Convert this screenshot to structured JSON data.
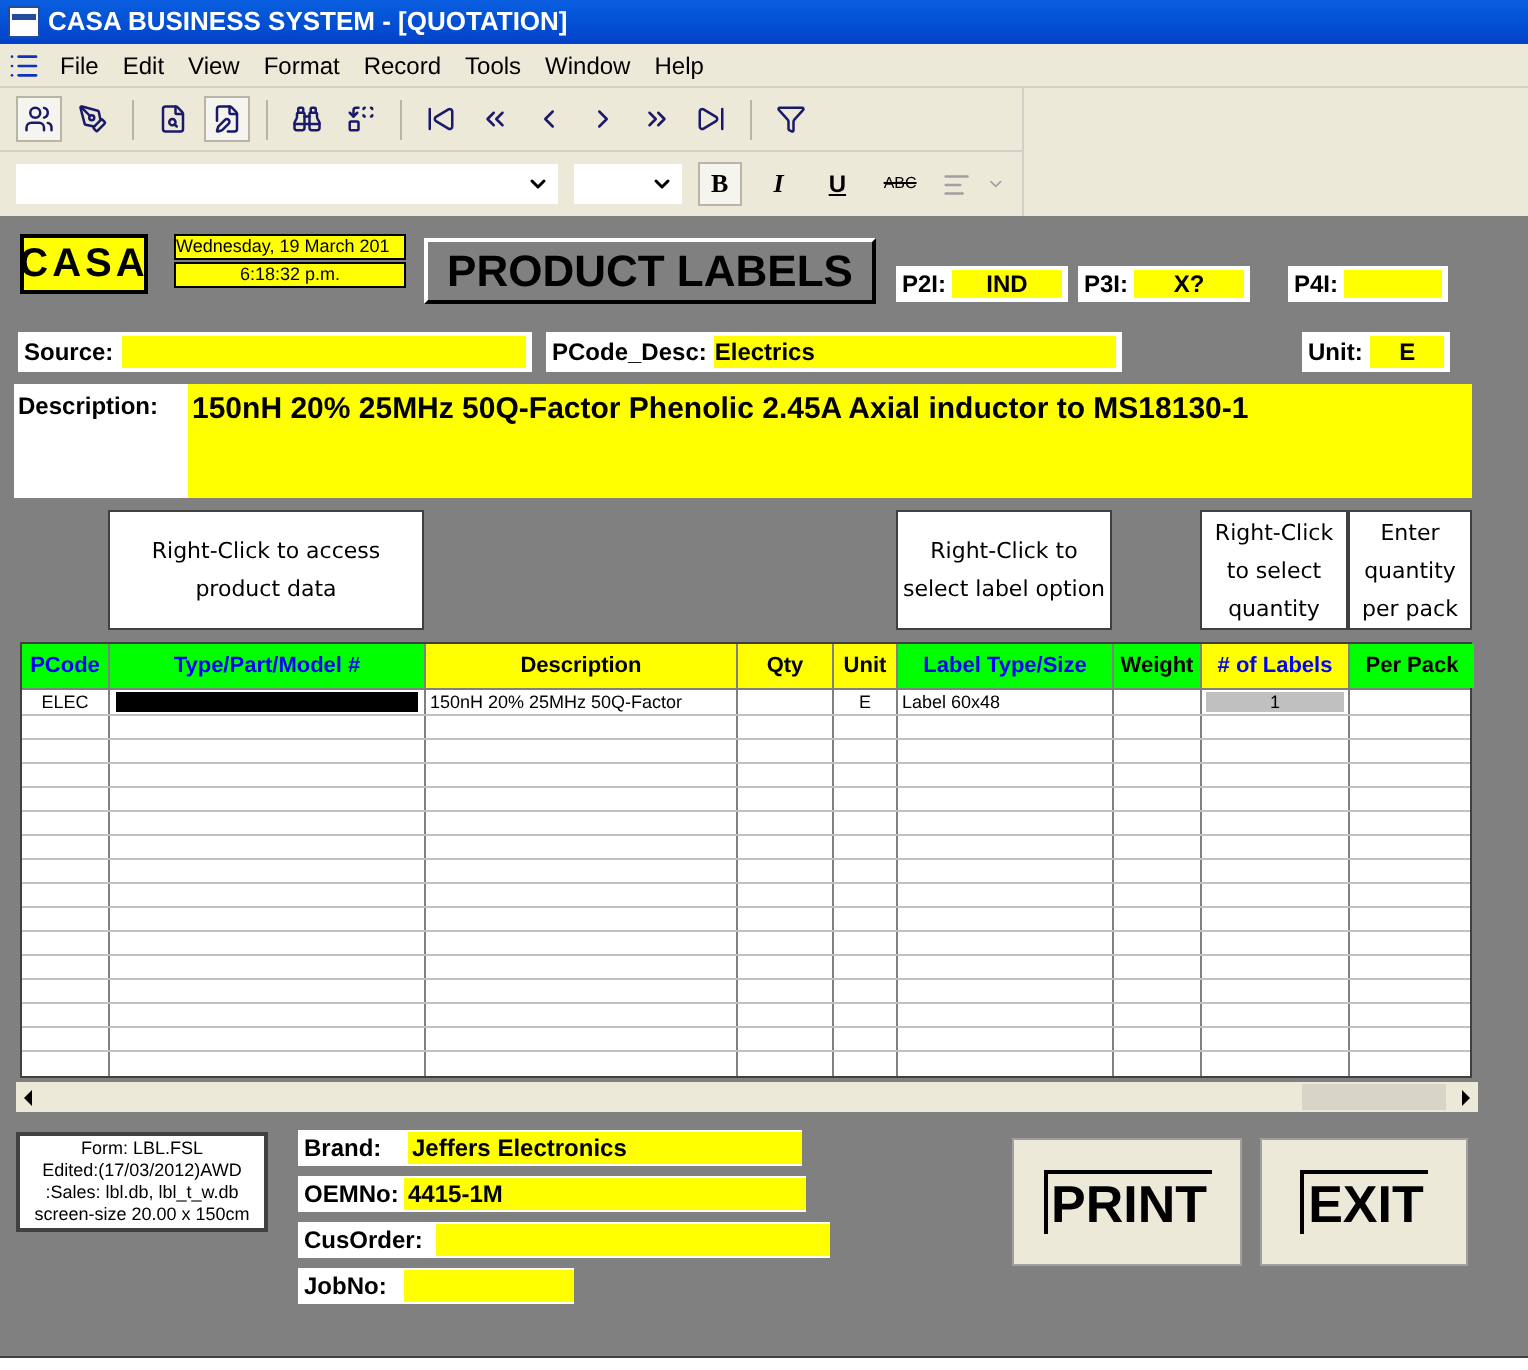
{
  "window": {
    "title": "CASA BUSINESS SYSTEM - [QUOTATION]"
  },
  "menu": [
    "File",
    "Edit",
    "View",
    "Format",
    "Record",
    "Tools",
    "Window",
    "Help"
  ],
  "format_toolbar": {
    "bold": "B",
    "italic": "I",
    "underline": "U",
    "strikethrough": "ABC"
  },
  "header": {
    "logo": "CASA",
    "date": "Wednesday, 19 March 201",
    "time": "6:18:32 p.m.",
    "title": "PRODUCT LABELS",
    "indicators": [
      {
        "label": "P2I:",
        "value": "IND"
      },
      {
        "label": "P3I:",
        "value": "X?"
      },
      {
        "label": "P4I:"
      }
    ]
  },
  "fields": {
    "source": {
      "label": "Source:"
    },
    "pcode_desc": {
      "label": "PCode_Desc:",
      "value": "Electrics"
    },
    "unit": {
      "label": "Unit:",
      "value": "E"
    },
    "description": {
      "label": "Description:",
      "value": "150nH 20% 25MHz 50Q-Factor Phenolic 2.45A Axial inductor to MS18130-1"
    }
  },
  "table": {
    "columns": [
      {
        "label": "PCode",
        "color": "#00ff00",
        "highlighted": true
      },
      {
        "label": "Type/Part/Model #",
        "color": "#00ff00",
        "highlighted": true,
        "hint": "Right-Click to access product data"
      },
      {
        "label": "Description",
        "color": "#ffff00",
        "highlighted": false
      },
      {
        "label": "Qty",
        "color": "#ffff00",
        "highlighted": false
      },
      {
        "label": "Unit",
        "color": "#ffff00",
        "highlighted": false
      },
      {
        "label": "Label Type/Size",
        "color": "#00ff00",
        "highlighted": true,
        "hint": "Right-Click to select label option"
      },
      {
        "label": "Weight",
        "color": "#00ff00",
        "highlighted": false
      },
      {
        "label": "# of Labels",
        "color": "#ffff00",
        "highlighted": true,
        "hint": "Right-Click to select quantity"
      },
      {
        "label": "Per Pack",
        "color": "#00ff00",
        "highlighted": false,
        "hint": "Enter quantity per pack"
      }
    ],
    "rows": [
      {
        "pcode": "ELEC",
        "masked": true,
        "description": "150nH 20% 25MHz 50Q-Factor",
        "unit": "E",
        "label_type": "Label 60x48",
        "labels": "1"
      }
    ]
  },
  "form_info": [
    "Form: LBL.FSL",
    "Edited:(17/03/2012)AWD",
    ":Sales: lbl.db, lbl_t_w.db",
    "screen-size 20.00 x 150cm"
  ],
  "order_fields": [
    {
      "label": "Brand:",
      "value": "Jeffers Electronics"
    },
    {
      "label": "OEMNo:",
      "value": "4415-1M"
    },
    {
      "label": "CusOrder:"
    },
    {
      "label": "JobNo:"
    }
  ],
  "buttons": [
    "PRINT",
    "EXIT"
  ]
}
